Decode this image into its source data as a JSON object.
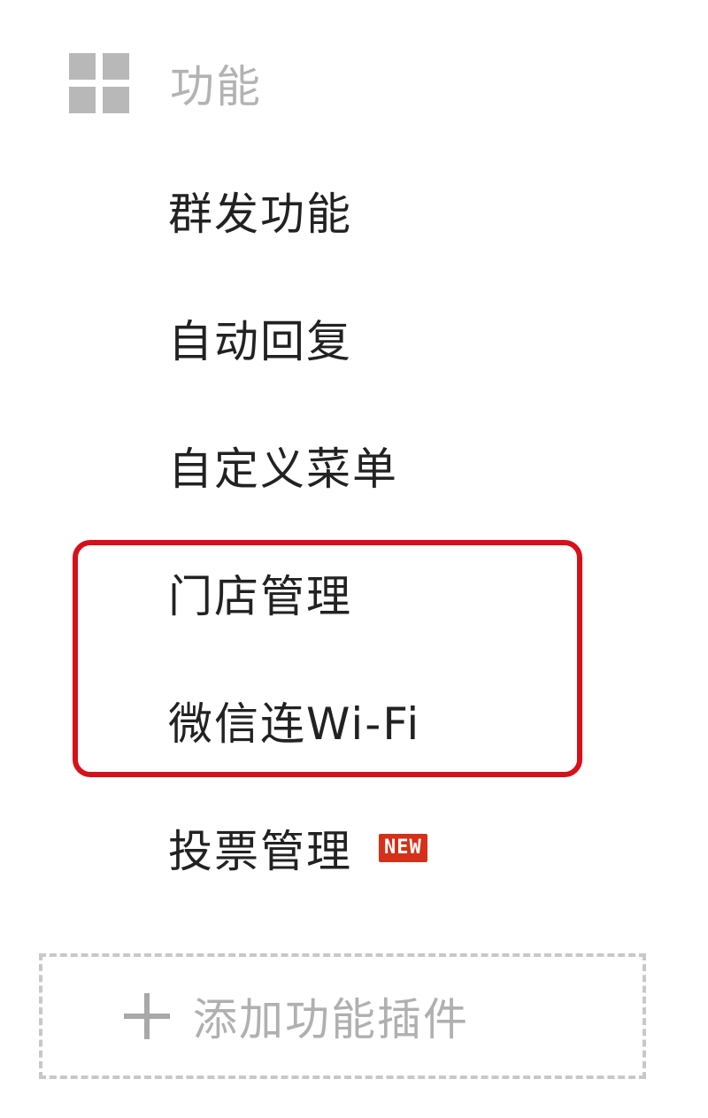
{
  "section": {
    "title": "功能",
    "icon": "grid-icon"
  },
  "menu": {
    "items": [
      {
        "label": "群发功能"
      },
      {
        "label": "自动回复"
      },
      {
        "label": "自定义菜单"
      },
      {
        "label": "门店管理"
      },
      {
        "label": "微信连Wi-Fi"
      },
      {
        "label": "投票管理",
        "badge": "NEW"
      }
    ]
  },
  "add_plugin": {
    "label": "添加功能插件",
    "icon": "plus-icon"
  },
  "colors": {
    "highlight": "#d7101a",
    "badge": "#d4301a",
    "muted_text": "#b3b3b3",
    "text": "#222222"
  }
}
